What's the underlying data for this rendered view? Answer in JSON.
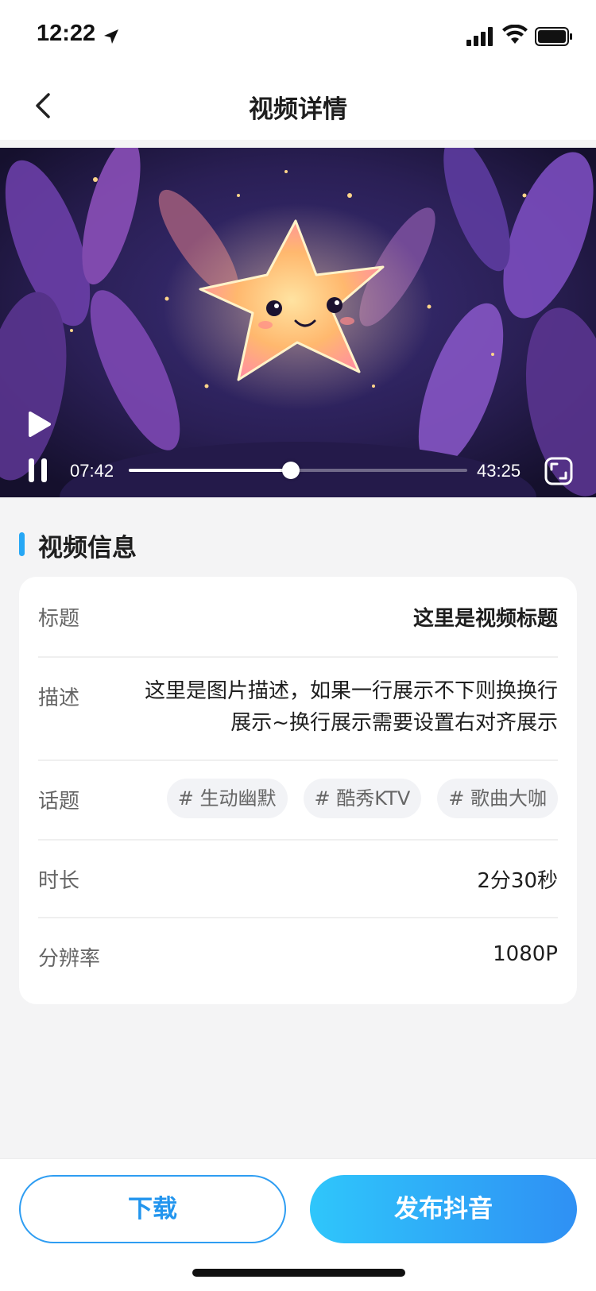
{
  "status_bar": {
    "time": "12:22",
    "icons": [
      "location-arrow-icon",
      "signal-icon",
      "wifi-icon",
      "battery-icon"
    ]
  },
  "nav": {
    "back_icon": "chevron-left-icon",
    "title": "视频详情"
  },
  "player": {
    "current_time": "07:42",
    "total_time": "43:25",
    "progress": 0.48,
    "icons": [
      "play-icon",
      "pause-icon",
      "fullscreen-icon"
    ]
  },
  "section": {
    "title": "视频信息",
    "accent_color": "#26a7f5"
  },
  "info": {
    "title_label": "标题",
    "title_value": "这里是视频标题",
    "desc_label": "描述",
    "desc_value": "这里是图片描述，如果一行展示不下则换换行展示~换行展示需要设置右对齐展示",
    "topic_label": "话题",
    "topics": [
      "# 生动幽默",
      "# 酷秀KTV",
      "# 歌曲大咖"
    ],
    "duration_label": "时长",
    "duration_value": "2分30秒",
    "resolution_label": "分辨率",
    "resolution_value": "1080P"
  },
  "actions": {
    "download_label": "下载",
    "publish_label": "发布抖音",
    "primary_gradient": [
      "#2fc6fb",
      "#2f90f4"
    ]
  }
}
